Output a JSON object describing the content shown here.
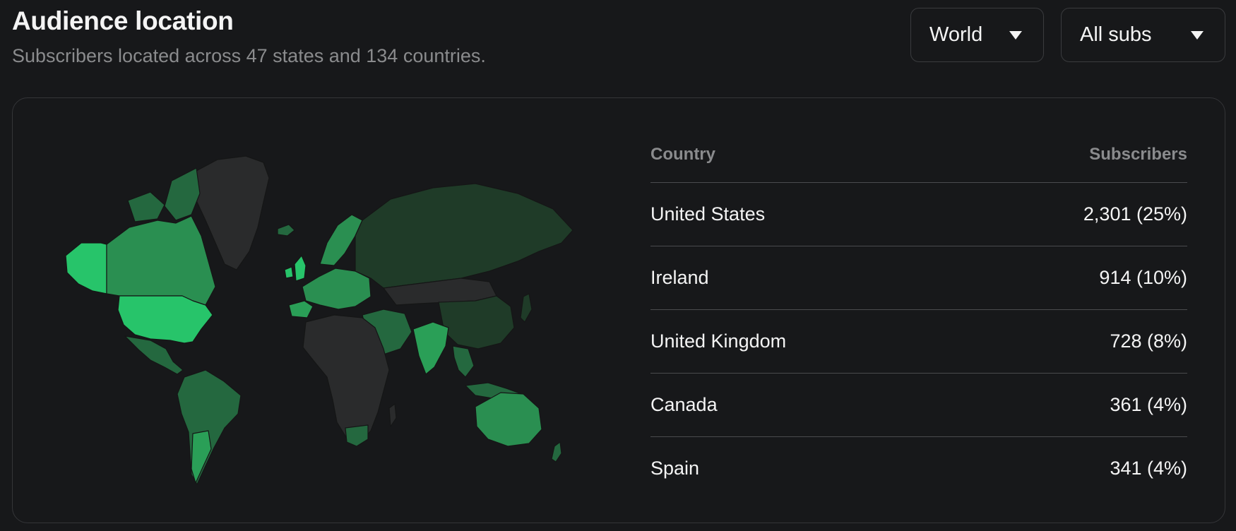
{
  "header": {
    "title": "Audience location",
    "subtitle": "Subscribers located across 47 states and 134 countries."
  },
  "filters": {
    "region": {
      "selected": "World"
    },
    "audience": {
      "selected": "All subs"
    }
  },
  "map": {
    "legend_scale_colors": {
      "highest": "#27c46a",
      "high": "#2a9f57",
      "medium": "#24683f",
      "low": "#1e3a28",
      "none": "#2a2b2c"
    }
  },
  "table": {
    "columns": {
      "country": "Country",
      "subscribers": "Subscribers"
    },
    "rows": [
      {
        "country": "United States",
        "subscribers": "2,301 (25%)"
      },
      {
        "country": "Ireland",
        "subscribers": "914 (10%)"
      },
      {
        "country": "United Kingdom",
        "subscribers": "728 (8%)"
      },
      {
        "country": "Canada",
        "subscribers": "361 (4%)"
      },
      {
        "country": "Spain",
        "subscribers": "341 (4%)"
      }
    ]
  }
}
